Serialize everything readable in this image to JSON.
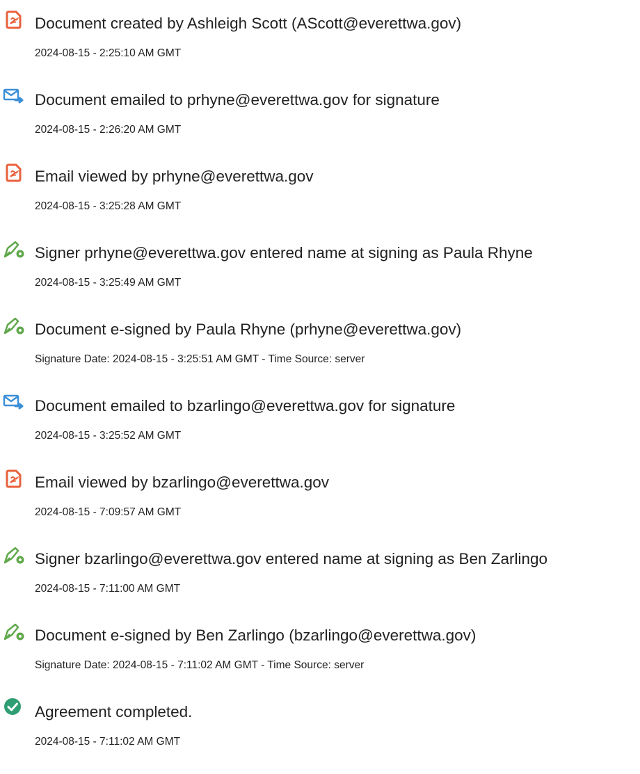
{
  "events": [
    {
      "icon": "pdf-document-icon",
      "title": "Document created by Ashleigh Scott (AScott@everettwa.gov)",
      "detail": "2024-08-15 - 2:25:10 AM GMT"
    },
    {
      "icon": "email-send-icon",
      "title": "Document emailed to prhyne@everettwa.gov for signature",
      "detail": "2024-08-15 - 2:26:20 AM GMT"
    },
    {
      "icon": "pdf-document-icon",
      "title": "Email viewed by prhyne@everettwa.gov",
      "detail": "2024-08-15 - 3:25:28 AM GMT"
    },
    {
      "icon": "pen-sign-icon",
      "title": "Signer prhyne@everettwa.gov entered name at signing as Paula Rhyne",
      "detail": "2024-08-15 - 3:25:49 AM GMT"
    },
    {
      "icon": "pen-sign-icon",
      "title": "Document e-signed by Paula Rhyne (prhyne@everettwa.gov)",
      "detail": "Signature Date: 2024-08-15 - 3:25:51 AM GMT - Time Source: server"
    },
    {
      "icon": "email-send-icon",
      "title": "Document emailed to bzarlingo@everettwa.gov for signature",
      "detail": "2024-08-15 - 3:25:52 AM GMT"
    },
    {
      "icon": "pdf-document-icon",
      "title": "Email viewed by bzarlingo@everettwa.gov",
      "detail": "2024-08-15 - 7:09:57 AM GMT"
    },
    {
      "icon": "pen-sign-icon",
      "title": "Signer bzarlingo@everettwa.gov entered name at signing as Ben Zarlingo",
      "detail": "2024-08-15 - 7:11:00 AM GMT"
    },
    {
      "icon": "pen-sign-icon",
      "title": "Document e-signed by Ben Zarlingo (bzarlingo@everettwa.gov)",
      "detail": "Signature Date: 2024-08-15 - 7:11:02 AM GMT - Time Source: server"
    },
    {
      "icon": "checkmark-circle-icon",
      "title": "Agreement completed.",
      "detail": "2024-08-15 - 7:11:02 AM GMT"
    }
  ],
  "colors": {
    "pdf_icon": "#e8613c",
    "email_icon": "#3b8fd9",
    "pen_icon": "#5fa84a",
    "check_icon": "#2f9e72",
    "text": "#222222"
  }
}
